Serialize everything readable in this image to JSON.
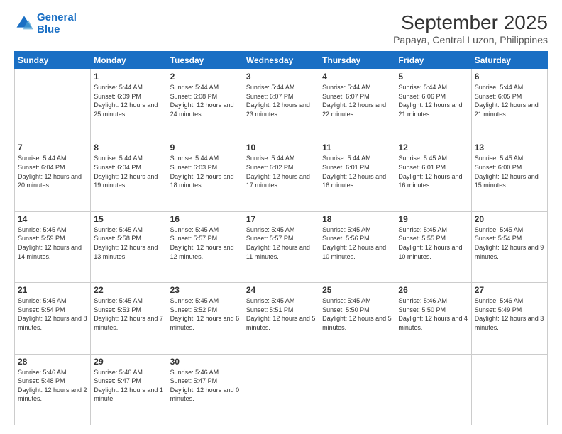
{
  "logo": {
    "line1": "General",
    "line2": "Blue"
  },
  "title": "September 2025",
  "location": "Papaya, Central Luzon, Philippines",
  "days_of_week": [
    "Sunday",
    "Monday",
    "Tuesday",
    "Wednesday",
    "Thursday",
    "Friday",
    "Saturday"
  ],
  "weeks": [
    [
      {
        "day": "",
        "sunrise": "",
        "sunset": "",
        "daylight": ""
      },
      {
        "day": "1",
        "sunrise": "Sunrise: 5:44 AM",
        "sunset": "Sunset: 6:09 PM",
        "daylight": "Daylight: 12 hours and 25 minutes."
      },
      {
        "day": "2",
        "sunrise": "Sunrise: 5:44 AM",
        "sunset": "Sunset: 6:08 PM",
        "daylight": "Daylight: 12 hours and 24 minutes."
      },
      {
        "day": "3",
        "sunrise": "Sunrise: 5:44 AM",
        "sunset": "Sunset: 6:07 PM",
        "daylight": "Daylight: 12 hours and 23 minutes."
      },
      {
        "day": "4",
        "sunrise": "Sunrise: 5:44 AM",
        "sunset": "Sunset: 6:07 PM",
        "daylight": "Daylight: 12 hours and 22 minutes."
      },
      {
        "day": "5",
        "sunrise": "Sunrise: 5:44 AM",
        "sunset": "Sunset: 6:06 PM",
        "daylight": "Daylight: 12 hours and 21 minutes."
      },
      {
        "day": "6",
        "sunrise": "Sunrise: 5:44 AM",
        "sunset": "Sunset: 6:05 PM",
        "daylight": "Daylight: 12 hours and 21 minutes."
      }
    ],
    [
      {
        "day": "7",
        "sunrise": "Sunrise: 5:44 AM",
        "sunset": "Sunset: 6:04 PM",
        "daylight": "Daylight: 12 hours and 20 minutes."
      },
      {
        "day": "8",
        "sunrise": "Sunrise: 5:44 AM",
        "sunset": "Sunset: 6:04 PM",
        "daylight": "Daylight: 12 hours and 19 minutes."
      },
      {
        "day": "9",
        "sunrise": "Sunrise: 5:44 AM",
        "sunset": "Sunset: 6:03 PM",
        "daylight": "Daylight: 12 hours and 18 minutes."
      },
      {
        "day": "10",
        "sunrise": "Sunrise: 5:44 AM",
        "sunset": "Sunset: 6:02 PM",
        "daylight": "Daylight: 12 hours and 17 minutes."
      },
      {
        "day": "11",
        "sunrise": "Sunrise: 5:44 AM",
        "sunset": "Sunset: 6:01 PM",
        "daylight": "Daylight: 12 hours and 16 minutes."
      },
      {
        "day": "12",
        "sunrise": "Sunrise: 5:45 AM",
        "sunset": "Sunset: 6:01 PM",
        "daylight": "Daylight: 12 hours and 16 minutes."
      },
      {
        "day": "13",
        "sunrise": "Sunrise: 5:45 AM",
        "sunset": "Sunset: 6:00 PM",
        "daylight": "Daylight: 12 hours and 15 minutes."
      }
    ],
    [
      {
        "day": "14",
        "sunrise": "Sunrise: 5:45 AM",
        "sunset": "Sunset: 5:59 PM",
        "daylight": "Daylight: 12 hours and 14 minutes."
      },
      {
        "day": "15",
        "sunrise": "Sunrise: 5:45 AM",
        "sunset": "Sunset: 5:58 PM",
        "daylight": "Daylight: 12 hours and 13 minutes."
      },
      {
        "day": "16",
        "sunrise": "Sunrise: 5:45 AM",
        "sunset": "Sunset: 5:57 PM",
        "daylight": "Daylight: 12 hours and 12 minutes."
      },
      {
        "day": "17",
        "sunrise": "Sunrise: 5:45 AM",
        "sunset": "Sunset: 5:57 PM",
        "daylight": "Daylight: 12 hours and 11 minutes."
      },
      {
        "day": "18",
        "sunrise": "Sunrise: 5:45 AM",
        "sunset": "Sunset: 5:56 PM",
        "daylight": "Daylight: 12 hours and 10 minutes."
      },
      {
        "day": "19",
        "sunrise": "Sunrise: 5:45 AM",
        "sunset": "Sunset: 5:55 PM",
        "daylight": "Daylight: 12 hours and 10 minutes."
      },
      {
        "day": "20",
        "sunrise": "Sunrise: 5:45 AM",
        "sunset": "Sunset: 5:54 PM",
        "daylight": "Daylight: 12 hours and 9 minutes."
      }
    ],
    [
      {
        "day": "21",
        "sunrise": "Sunrise: 5:45 AM",
        "sunset": "Sunset: 5:54 PM",
        "daylight": "Daylight: 12 hours and 8 minutes."
      },
      {
        "day": "22",
        "sunrise": "Sunrise: 5:45 AM",
        "sunset": "Sunset: 5:53 PM",
        "daylight": "Daylight: 12 hours and 7 minutes."
      },
      {
        "day": "23",
        "sunrise": "Sunrise: 5:45 AM",
        "sunset": "Sunset: 5:52 PM",
        "daylight": "Daylight: 12 hours and 6 minutes."
      },
      {
        "day": "24",
        "sunrise": "Sunrise: 5:45 AM",
        "sunset": "Sunset: 5:51 PM",
        "daylight": "Daylight: 12 hours and 5 minutes."
      },
      {
        "day": "25",
        "sunrise": "Sunrise: 5:45 AM",
        "sunset": "Sunset: 5:50 PM",
        "daylight": "Daylight: 12 hours and 5 minutes."
      },
      {
        "day": "26",
        "sunrise": "Sunrise: 5:46 AM",
        "sunset": "Sunset: 5:50 PM",
        "daylight": "Daylight: 12 hours and 4 minutes."
      },
      {
        "day": "27",
        "sunrise": "Sunrise: 5:46 AM",
        "sunset": "Sunset: 5:49 PM",
        "daylight": "Daylight: 12 hours and 3 minutes."
      }
    ],
    [
      {
        "day": "28",
        "sunrise": "Sunrise: 5:46 AM",
        "sunset": "Sunset: 5:48 PM",
        "daylight": "Daylight: 12 hours and 2 minutes."
      },
      {
        "day": "29",
        "sunrise": "Sunrise: 5:46 AM",
        "sunset": "Sunset: 5:47 PM",
        "daylight": "Daylight: 12 hours and 1 minute."
      },
      {
        "day": "30",
        "sunrise": "Sunrise: 5:46 AM",
        "sunset": "Sunset: 5:47 PM",
        "daylight": "Daylight: 12 hours and 0 minutes."
      },
      {
        "day": "",
        "sunrise": "",
        "sunset": "",
        "daylight": ""
      },
      {
        "day": "",
        "sunrise": "",
        "sunset": "",
        "daylight": ""
      },
      {
        "day": "",
        "sunrise": "",
        "sunset": "",
        "daylight": ""
      },
      {
        "day": "",
        "sunrise": "",
        "sunset": "",
        "daylight": ""
      }
    ]
  ]
}
